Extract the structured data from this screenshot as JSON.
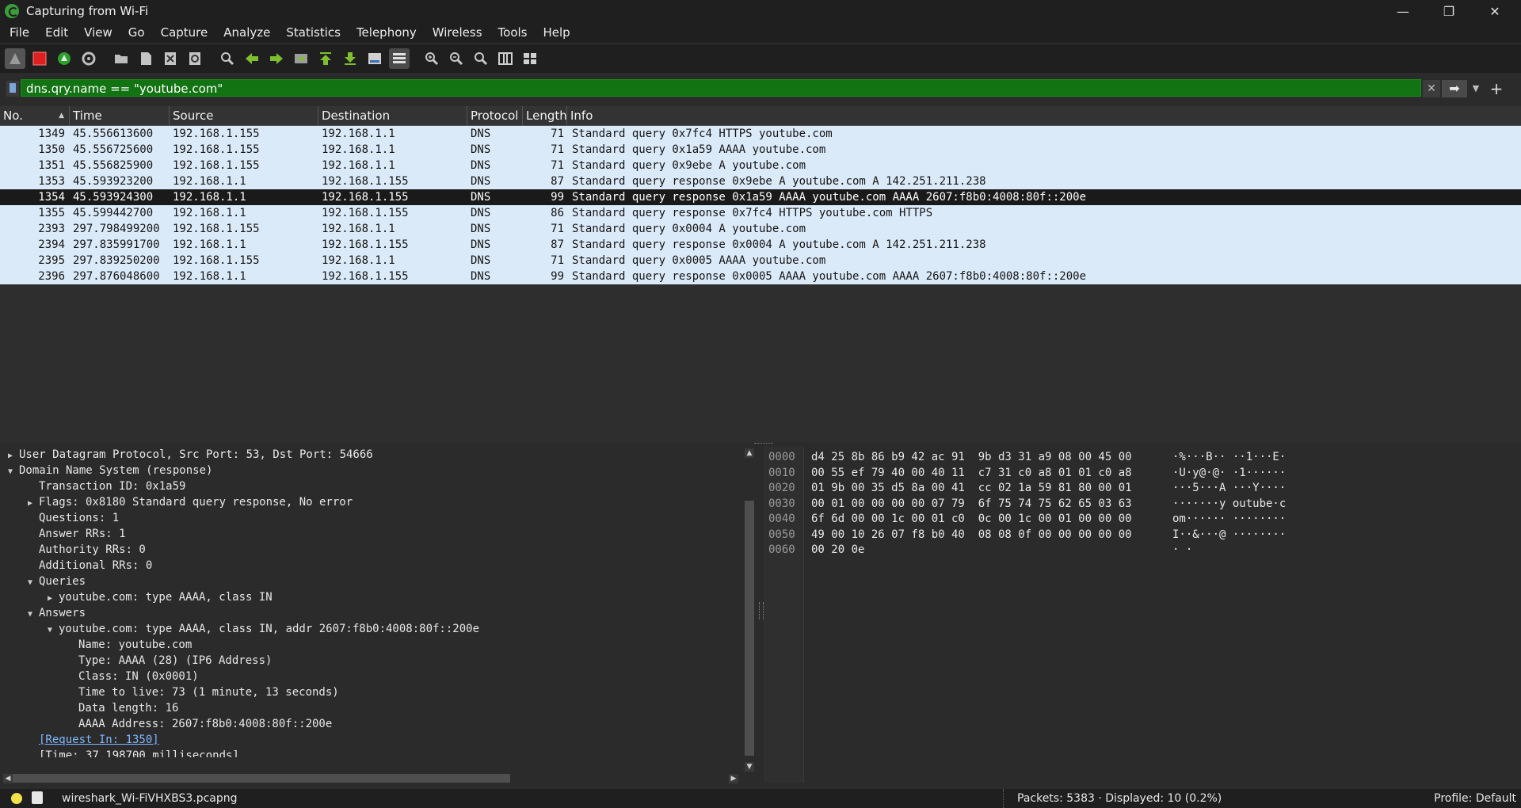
{
  "window": {
    "title": "Capturing from Wi-Fi",
    "controls": {
      "minimize": "—",
      "maximize": "❐",
      "close": "✕"
    }
  },
  "menu": [
    "File",
    "Edit",
    "View",
    "Go",
    "Capture",
    "Analyze",
    "Statistics",
    "Telephony",
    "Wireless",
    "Tools",
    "Help"
  ],
  "toolbar": {
    "icons": [
      "shark-fin-start-icon",
      "stop-capture-icon",
      "restart-capture-icon",
      "capture-options-icon",
      "open-file-icon",
      "save-file-icon",
      "close-file-icon",
      "reload-file-icon",
      "find-packet-icon",
      "go-back-icon",
      "go-forward-icon",
      "go-to-packet-icon",
      "go-first-icon",
      "go-last-icon",
      "auto-scroll-icon",
      "colorize-icon",
      "zoom-in-icon",
      "zoom-out-icon",
      "normal-size-icon",
      "resize-columns-icon",
      "layout-icon"
    ]
  },
  "filter": {
    "value": "dns.qry.name == \"youtube.com\"",
    "clear_icon": "✕",
    "apply_icon": "➡",
    "dropdown_icon": "▼",
    "add_icon": "+",
    "accent": "#127312"
  },
  "packet_list": {
    "columns": [
      "No.",
      "Time",
      "Source",
      "Destination",
      "Protocol",
      "Length",
      "Info"
    ],
    "rows": [
      {
        "no": "1349",
        "time": "45.556613600",
        "source": "192.168.1.155",
        "destination": "192.168.1.1",
        "protocol": "DNS",
        "length": "71",
        "info": "Standard query 0x7fc4 HTTPS youtube.com"
      },
      {
        "no": "1350",
        "time": "45.556725600",
        "source": "192.168.1.155",
        "destination": "192.168.1.1",
        "protocol": "DNS",
        "length": "71",
        "info": "Standard query 0x1a59 AAAA youtube.com"
      },
      {
        "no": "1351",
        "time": "45.556825900",
        "source": "192.168.1.155",
        "destination": "192.168.1.1",
        "protocol": "DNS",
        "length": "71",
        "info": "Standard query 0x9ebe A youtube.com"
      },
      {
        "no": "1353",
        "time": "45.593923200",
        "source": "192.168.1.1",
        "destination": "192.168.1.155",
        "protocol": "DNS",
        "length": "87",
        "info": "Standard query response 0x9ebe A youtube.com A 142.251.211.238"
      },
      {
        "no": "1354",
        "time": "45.593924300",
        "source": "192.168.1.1",
        "destination": "192.168.1.155",
        "protocol": "DNS",
        "length": "99",
        "info": "Standard query response 0x1a59 AAAA youtube.com AAAA 2607:f8b0:4008:80f::200e",
        "selected": true
      },
      {
        "no": "1355",
        "time": "45.599442700",
        "source": "192.168.1.1",
        "destination": "192.168.1.155",
        "protocol": "DNS",
        "length": "86",
        "info": "Standard query response 0x7fc4 HTTPS youtube.com HTTPS"
      },
      {
        "no": "2393",
        "time": "297.798499200",
        "source": "192.168.1.155",
        "destination": "192.168.1.1",
        "protocol": "DNS",
        "length": "71",
        "info": "Standard query 0x0004 A youtube.com"
      },
      {
        "no": "2394",
        "time": "297.835991700",
        "source": "192.168.1.1",
        "destination": "192.168.1.155",
        "protocol": "DNS",
        "length": "87",
        "info": "Standard query response 0x0004 A youtube.com A 142.251.211.238"
      },
      {
        "no": "2395",
        "time": "297.839250200",
        "source": "192.168.1.155",
        "destination": "192.168.1.1",
        "protocol": "DNS",
        "length": "71",
        "info": "Standard query 0x0005 AAAA youtube.com"
      },
      {
        "no": "2396",
        "time": "297.876048600",
        "source": "192.168.1.1",
        "destination": "192.168.1.155",
        "protocol": "DNS",
        "length": "99",
        "info": "Standard query response 0x0005 AAAA youtube.com AAAA 2607:f8b0:4008:80f::200e"
      }
    ],
    "row_color": "#dbeaf9",
    "selected_color": "#1a1a1a"
  },
  "details": {
    "lines": [
      {
        "text": "User Datagram Protocol, Src Port: 53, Dst Port: 54666",
        "indent": 0,
        "arrow": "▶"
      },
      {
        "text": "Domain Name System (response)",
        "indent": 0,
        "arrow": "▼"
      },
      {
        "text": "Transaction ID: 0x1a59",
        "indent": 1,
        "arrow": ""
      },
      {
        "text": "Flags: 0x8180 Standard query response, No error",
        "indent": 1,
        "arrow": "▶"
      },
      {
        "text": "Questions: 1",
        "indent": 1,
        "arrow": ""
      },
      {
        "text": "Answer RRs: 1",
        "indent": 1,
        "arrow": ""
      },
      {
        "text": "Authority RRs: 0",
        "indent": 1,
        "arrow": ""
      },
      {
        "text": "Additional RRs: 0",
        "indent": 1,
        "arrow": ""
      },
      {
        "text": "Queries",
        "indent": 1,
        "arrow": "▼"
      },
      {
        "text": "youtube.com: type AAAA, class IN",
        "indent": 2,
        "arrow": "▶"
      },
      {
        "text": "Answers",
        "indent": 1,
        "arrow": "▼"
      },
      {
        "text": "youtube.com: type AAAA, class IN, addr 2607:f8b0:4008:80f::200e",
        "indent": 2,
        "arrow": "▼"
      },
      {
        "text": "Name: youtube.com",
        "indent": 3,
        "arrow": ""
      },
      {
        "text": "Type: AAAA (28) (IP6 Address)",
        "indent": 3,
        "arrow": ""
      },
      {
        "text": "Class: IN (0x0001)",
        "indent": 3,
        "arrow": ""
      },
      {
        "text": "Time to live: 73 (1 minute, 13 seconds)",
        "indent": 3,
        "arrow": ""
      },
      {
        "text": "Data length: 16",
        "indent": 3,
        "arrow": ""
      },
      {
        "text": "AAAA Address: 2607:f8b0:4008:80f::200e",
        "indent": 3,
        "arrow": ""
      },
      {
        "text": "[Request In: 1350]",
        "indent": 1,
        "arrow": "",
        "link": true
      },
      {
        "text": "[Time: 37.198700 milliseconds]",
        "indent": 1,
        "arrow": ""
      }
    ]
  },
  "bytes": {
    "rows": [
      {
        "offset": "0000",
        "hex": "d4 25 8b 86 b9 42 ac 91  9b d3 31 a9 08 00 45 00",
        "ascii": "·%···B·· ··1···E·"
      },
      {
        "offset": "0010",
        "hex": "00 55 ef 79 40 00 40 11  c7 31 c0 a8 01 01 c0 a8",
        "ascii": "·U·y@·@· ·1······"
      },
      {
        "offset": "0020",
        "hex": "01 9b 00 35 d5 8a 00 41  cc 02 1a 59 81 80 00 01",
        "ascii": "···5···A ···Y····"
      },
      {
        "offset": "0030",
        "hex": "00 01 00 00 00 00 07 79  6f 75 74 75 62 65 03 63",
        "ascii": "·······y outube·c"
      },
      {
        "offset": "0040",
        "hex": "6f 6d 00 00 1c 00 01 c0  0c 00 1c 00 01 00 00 00",
        "ascii": "om······ ········"
      },
      {
        "offset": "0050",
        "hex": "49 00 10 26 07 f8 b0 40  08 08 0f 00 00 00 00 00",
        "ascii": "I··&···@ ········"
      },
      {
        "offset": "0060",
        "hex": "00 20 0e",
        "ascii": "· ·"
      }
    ]
  },
  "status": {
    "file": "wireshark_Wi-FiVHXBS3.pcapng",
    "packets": "Packets: 5383 · Displayed: 10 (0.2%)",
    "profile": "Profile: Default"
  }
}
